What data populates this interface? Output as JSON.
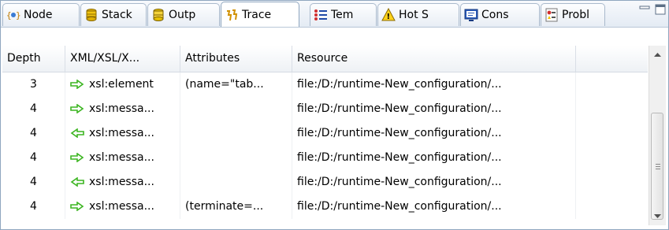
{
  "tabs": [
    {
      "label": "Node",
      "icon": "node-icon",
      "active": false
    },
    {
      "label": "Stack",
      "icon": "stack-icon",
      "active": false
    },
    {
      "label": "Outp",
      "icon": "output-icon",
      "active": false
    },
    {
      "label": "Trace",
      "icon": "trace-icon",
      "active": true
    },
    {
      "label": "Tem",
      "icon": "template-icon",
      "active": false
    },
    {
      "label": "Hot S",
      "icon": "hot-spots-icon",
      "active": false
    },
    {
      "label": "Cons",
      "icon": "console-icon",
      "active": false
    },
    {
      "label": "Probl",
      "icon": "problems-icon",
      "active": false
    }
  ],
  "window_controls": {
    "minimize_icon": "minimize-icon",
    "maximize_icon": "maximize-icon"
  },
  "table": {
    "columns": [
      "Depth",
      "XML/XSL/X...",
      "Attributes",
      "Resource"
    ],
    "rows": [
      {
        "depth": "3",
        "direction": "enter",
        "element": "xsl:element",
        "attributes": "(name=\"tab...",
        "resource": "file:/D:/runtime-New_configuration/..."
      },
      {
        "depth": "4",
        "direction": "enter",
        "element": "xsl:messa...",
        "attributes": "",
        "resource": "file:/D:/runtime-New_configuration/..."
      },
      {
        "depth": "4",
        "direction": "exit",
        "element": "xsl:messa...",
        "attributes": "",
        "resource": "file:/D:/runtime-New_configuration/..."
      },
      {
        "depth": "4",
        "direction": "enter",
        "element": "xsl:messa...",
        "attributes": "",
        "resource": "file:/D:/runtime-New_configuration/..."
      },
      {
        "depth": "4",
        "direction": "exit",
        "element": "xsl:messa...",
        "attributes": "",
        "resource": "file:/D:/runtime-New_configuration/..."
      },
      {
        "depth": "4",
        "direction": "enter",
        "element": "xsl:messa...",
        "attributes": "(terminate=...",
        "resource": "file:/D:/runtime-New_configuration/..."
      }
    ]
  },
  "colors": {
    "enter_arrow": "#3cb521",
    "exit_arrow": "#3cb521",
    "tab_border": "#a9b9cc"
  }
}
